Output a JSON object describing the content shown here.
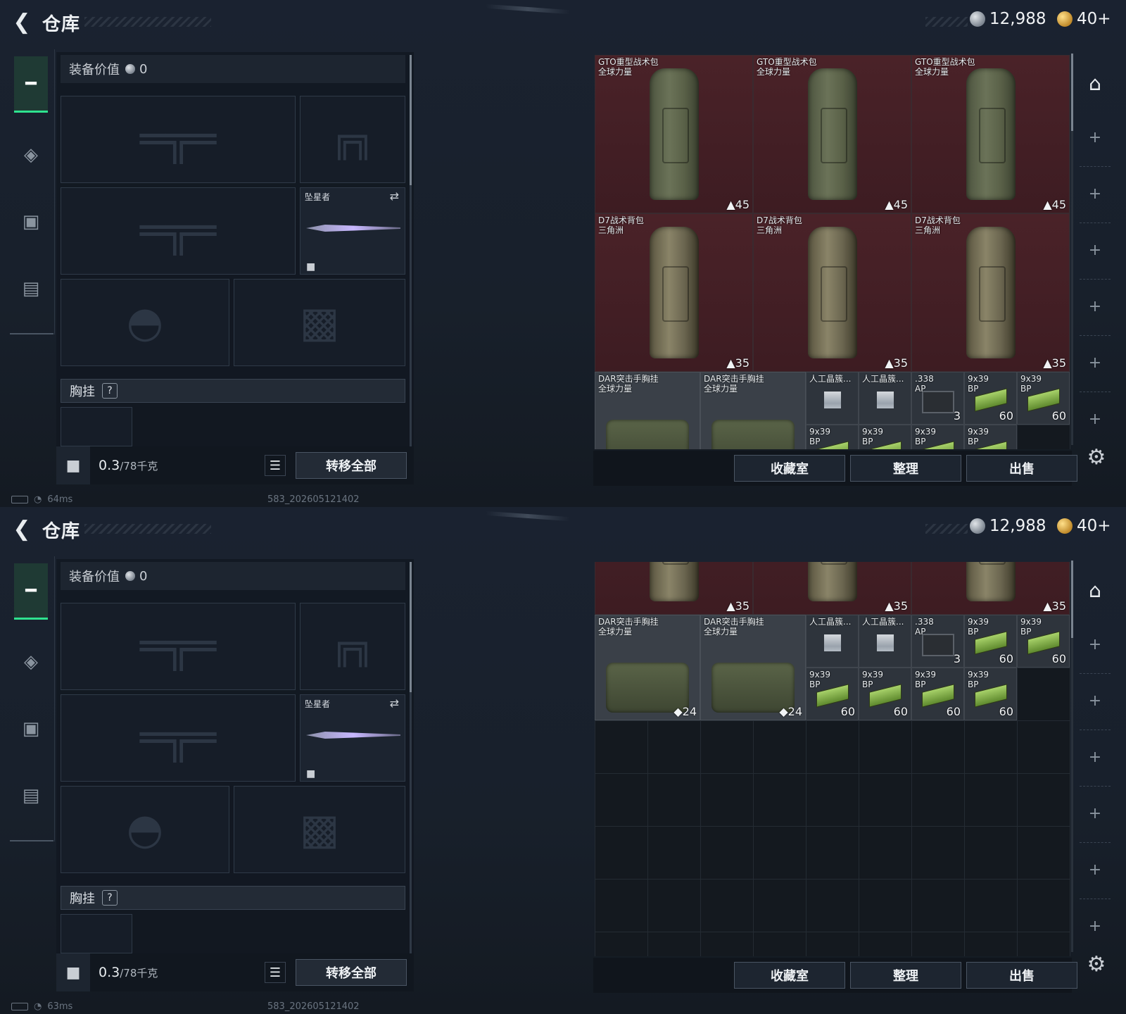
{
  "header": {
    "title": "仓库",
    "silver": "12,988",
    "gold": "40+"
  },
  "sidebar": {
    "tabs": [
      "weapons",
      "armor",
      "backpack",
      "tools"
    ]
  },
  "equipment": {
    "value_label": "装备价值",
    "value": "0",
    "melee_name": "坠星者",
    "chest_label": "胸挂",
    "chest_help": "?"
  },
  "capacity": {
    "current": "0.3",
    "max": "/78千克"
  },
  "buttons": {
    "transfer_all": "转移全部",
    "collection": "收藏室",
    "organize": "整理",
    "sell": "出售"
  },
  "status": {
    "ping_top": "64ms",
    "ping_bottom": "63ms",
    "session": "583_202605121402"
  },
  "top_items": [
    {
      "name": "GTO重型战术包\n全球力量",
      "count": "45"
    },
    {
      "name": "GTO重型战术包\n全球力量",
      "count": "45"
    },
    {
      "name": "GTO重型战术包\n全球力量",
      "count": "45"
    },
    {
      "name": "D7战术背包\n三角洲",
      "count": "35"
    },
    {
      "name": "D7战术背包\n三角洲",
      "count": "35"
    },
    {
      "name": "D7战术背包\n三角洲",
      "count": "35"
    }
  ],
  "small_items": [
    {
      "name": "DAR突击手胸挂\n全球力量",
      "count": "24"
    },
    {
      "name": "人工晶簇...",
      "count": ""
    },
    {
      "name": ".338\nAP",
      "count": "3"
    },
    {
      "name": "9x39\nBP",
      "count": "60"
    }
  ]
}
